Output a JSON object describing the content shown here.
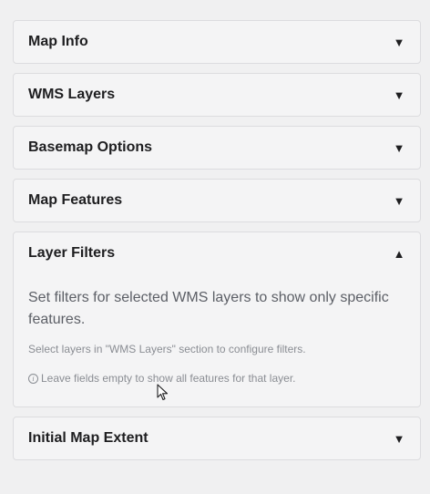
{
  "sections": [
    {
      "title": "Map Info",
      "arrow": "▼"
    },
    {
      "title": "WMS Layers",
      "arrow": "▼"
    },
    {
      "title": "Basemap Options",
      "arrow": "▼"
    },
    {
      "title": "Map Features",
      "arrow": "▼"
    },
    {
      "title": "Layer Filters",
      "arrow": "▲",
      "description": "Set filters for selected WMS layers to show only specific features.",
      "hint": "Select layers in \"WMS Layers\" section to configure filters.",
      "note": "Leave fields empty to show all features for that layer.",
      "note_icon": "info-icon"
    },
    {
      "title": "Initial Map Extent",
      "arrow": "▼"
    }
  ]
}
